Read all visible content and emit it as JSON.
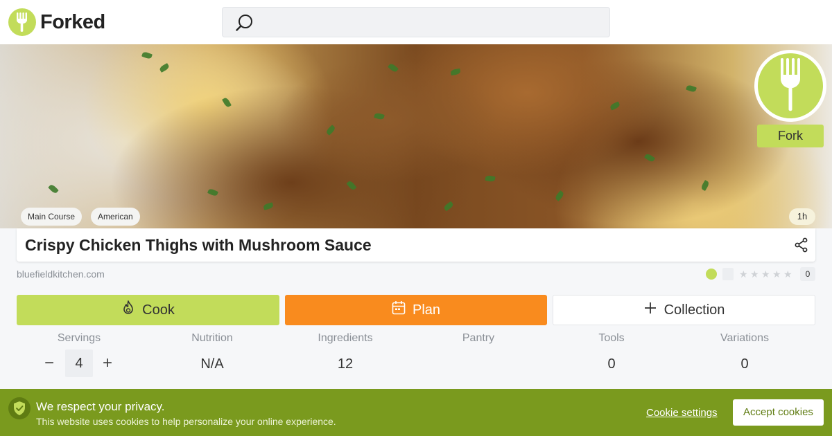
{
  "header": {
    "logo_text": "Forked",
    "search": {
      "placeholder": "",
      "value": ""
    }
  },
  "hero": {
    "badge_label": "Fork",
    "tags": [
      "Main Course",
      "American"
    ],
    "time": "1h"
  },
  "recipe": {
    "title": "Crispy Chicken Thighs with Mushroom Sauce",
    "source": "bluefieldkitchen.com",
    "rating": {
      "stars": 0,
      "max_stars": 5,
      "count": "0"
    }
  },
  "actions": {
    "cook_label": "Cook",
    "plan_label": "Plan",
    "collection_label": "Collection"
  },
  "stats": {
    "servings": {
      "label": "Servings",
      "value": "4"
    },
    "nutrition": {
      "label": "Nutrition",
      "value": "N/A"
    },
    "ingredients": {
      "label": "Ingredients",
      "value": "12"
    },
    "pantry": {
      "label": "Pantry",
      "value": ""
    },
    "tools": {
      "label": "Tools",
      "value": "0"
    },
    "variations": {
      "label": "Variations",
      "value": "0"
    }
  },
  "cookie_banner": {
    "title": "We respect your privacy.",
    "text": "This website uses cookies to help personalize your online experience.",
    "settings_label": "Cookie settings",
    "accept_label": "Accept cookies"
  },
  "colors": {
    "brand_green": "#c2dc5a",
    "plan_orange": "#f98b1e",
    "cookie_green": "#7a9a1e"
  },
  "icons": [
    "fork-icon",
    "search-icon",
    "share-icon",
    "flame-icon",
    "calendar-icon",
    "plus-icon",
    "shield-check-icon",
    "star-icon"
  ]
}
